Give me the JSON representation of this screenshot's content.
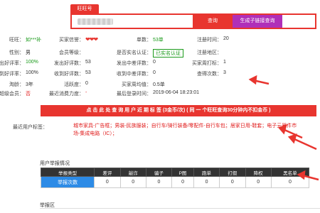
{
  "search": {
    "tab_label": "旺旺号",
    "input_value": "",
    "query_button": "查询",
    "gen_button": "生成子链接查询"
  },
  "info": {
    "rows": [
      [
        {
          "label": "旺旺：",
          "value": "如***补",
          "cls": "green"
        },
        {
          "label": "买家信誉：",
          "value": "❤❤❤",
          "cls": "hearts"
        },
        {
          "label": "单数：",
          "value": "53单",
          "cls": "green"
        },
        {
          "label": "注册时间：",
          "value": "20",
          "cls": "val"
        }
      ],
      [
        {
          "label": "性别：",
          "value": "男",
          "cls": "val"
        },
        {
          "label": "会员等级：",
          "value": "",
          "cls": "val"
        },
        {
          "label": "是否实名认证：",
          "value": "已实名认证",
          "cls": "green"
        },
        {
          "label": "注册地区：",
          "value": "",
          "cls": "val"
        }
      ],
      [
        {
          "label": "发出好评率：",
          "value": "100%",
          "cls": "green"
        },
        {
          "label": "发出好评数：",
          "value": "53",
          "cls": "val"
        },
        {
          "label": "发出中差评数：",
          "value": "0",
          "cls": "val"
        },
        {
          "label": "买家周打标：",
          "value": "1",
          "cls": "val"
        }
      ],
      [
        {
          "label": "收到好评率：",
          "value": "100%",
          "cls": "val"
        },
        {
          "label": "收到好评数：",
          "value": "53",
          "cls": "val"
        },
        {
          "label": "收到中差评数：",
          "value": "0",
          "cls": "val"
        },
        {
          "label": "查得次数：",
          "value": "3",
          "cls": "val"
        }
      ],
      [
        {
          "label": "淘龄：",
          "value": "3年",
          "cls": "val"
        },
        {
          "label": "活跃度：",
          "value": "0",
          "cls": "val"
        },
        {
          "label": "买家周均值：",
          "value": "0.5单",
          "cls": "val"
        },
        {
          "label": "",
          "value": "",
          "cls": "val"
        }
      ],
      [
        {
          "label": "是否超级会员：",
          "value": "否",
          "cls": "red"
        },
        {
          "label": "最近消费力度：",
          "value": "-",
          "cls": "red"
        },
        {
          "label": "最后登录时间：",
          "value": "2019-06-04 18:23:01",
          "cls": "val"
        },
        {
          "label": "",
          "value": "",
          "cls": "val"
        }
      ]
    ]
  },
  "banner": "点 击 此 处 查 询 用 户 近 期 标 签 (3金币/次) ( 同 一 个旺旺查询30分钟内不扣金币 )",
  "tags": {
    "label": "最近用户标签：",
    "text": "城市家具-广告框；男装-民族服装；自行车/骑行装备/零配件-自行车包；居家日用-鞋套；电子元器件市场-集成电路（IC）；"
  },
  "report": {
    "title": "用户举报情况",
    "headers": [
      "举报类型",
      "差评",
      "敲诈",
      "骗子",
      "P图",
      "跑单",
      "打假",
      "降权",
      "黑名单"
    ],
    "row_label": "举报次数",
    "values": [
      "0",
      "0",
      "0",
      "0",
      "0",
      "0",
      "0",
      "0"
    ],
    "bottom_title": "举报区"
  },
  "colors": {
    "accent": "#e8352f",
    "gen_button": "#b02fb8",
    "report_first_cell": "#2d8be6"
  }
}
